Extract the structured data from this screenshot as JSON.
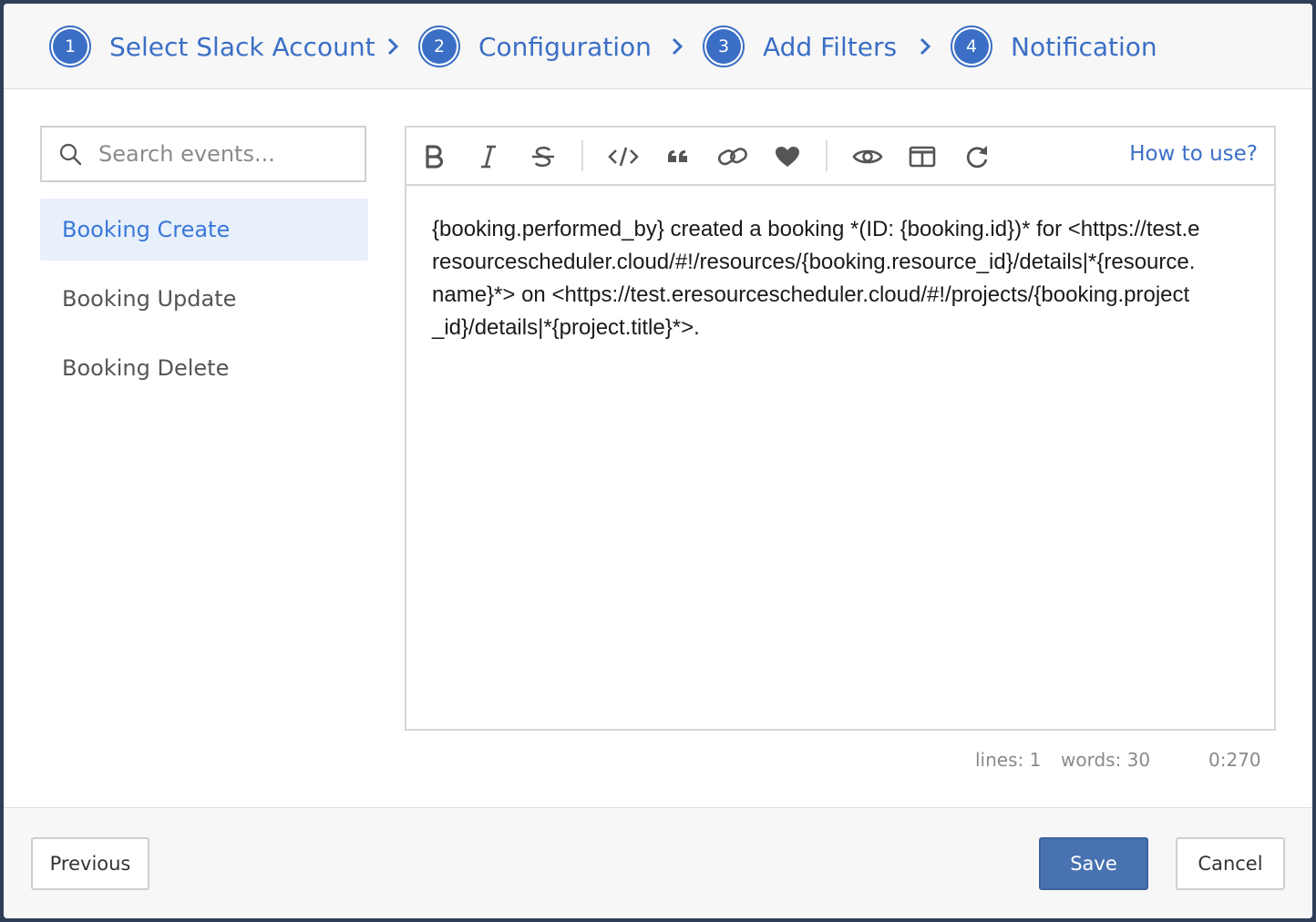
{
  "wizard": {
    "steps": [
      {
        "number": "1",
        "label": "Select Slack Account"
      },
      {
        "number": "2",
        "label": "Configuration"
      },
      {
        "number": "3",
        "label": "Add Filters"
      },
      {
        "number": "4",
        "label": "Notification"
      }
    ]
  },
  "sidebar": {
    "search_placeholder": "Search events...",
    "search_value": "",
    "events": [
      {
        "label": "Booking Create",
        "active": true
      },
      {
        "label": "Booking Update",
        "active": false
      },
      {
        "label": "Booking Delete",
        "active": false
      }
    ]
  },
  "editor": {
    "toolbar": {
      "tools": [
        "bold-icon",
        "italic-icon",
        "strikethrough-icon",
        "code-icon",
        "quote-icon",
        "link-icon",
        "heart-icon",
        "eye-icon",
        "columns-icon",
        "redo-icon"
      ],
      "help_link": "How to use?"
    },
    "content": "{booking.performed_by} created a booking *(ID: {booking.id})* for <https://test.eresourcescheduler.cloud/#!/resources/{booking.resource_id}/details|*{resource.name}*> on <https://test.eresourcescheduler.cloud/#!/projects/{booking.project_id}/details|*{project.title}*>.",
    "status": {
      "lines": "lines: 1",
      "words": "words: 30",
      "cursor": "0:270"
    }
  },
  "footer": {
    "previous_label": "Previous",
    "save_label": "Save",
    "cancel_label": "Cancel"
  },
  "colors": {
    "accent": "#3b6fc6",
    "primary_button": "#4872b0",
    "active_item_bg": "#e8f0fb"
  }
}
